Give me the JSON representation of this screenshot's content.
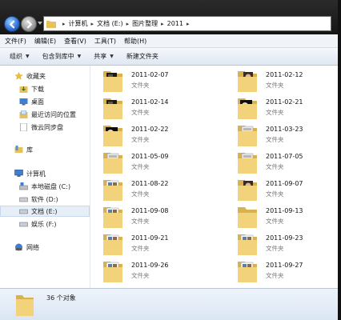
{
  "address": {
    "crumbs": [
      "计算机",
      "文档 (E:)",
      "图片整理",
      "2011"
    ]
  },
  "menu": [
    "文件(F)",
    "编辑(E)",
    "查看(V)",
    "工具(T)",
    "帮助(H)"
  ],
  "toolbar": {
    "organize": "组织",
    "include_library": "包含到库中",
    "share": "共享",
    "new_folder": "新建文件夹"
  },
  "nav": {
    "favorites": "收藏夹",
    "downloads": "下载",
    "desktop": "桌面",
    "recent": "最近访问的位置",
    "weiyun": "微云同步盘",
    "library": "库",
    "computer": "计算机",
    "drive_c": "本地磁盘 (C:)",
    "drive_d": "软件 (D:)",
    "drive_e": "文档 (E:)",
    "drive_f": "娱乐 (F:)",
    "network": "网络"
  },
  "folder_kind": "文件夹",
  "folders": [
    {
      "name": "2011-02-07",
      "thumb": "dark-photo"
    },
    {
      "name": "2011-02-12",
      "thumb": "portrait"
    },
    {
      "name": "2011-02-14",
      "thumb": "dark-photo"
    },
    {
      "name": "2011-02-21",
      "thumb": "bw-photo"
    },
    {
      "name": "2011-02-22",
      "thumb": "bw-photo"
    },
    {
      "name": "2011-03-23",
      "thumb": "gray-grid"
    },
    {
      "name": "2011-05-09",
      "thumb": "gray-grid"
    },
    {
      "name": "2011-07-05",
      "thumb": "gray-grid"
    },
    {
      "name": "2011-08-22",
      "thumb": "collage"
    },
    {
      "name": "2011-09-07",
      "thumb": "portrait"
    },
    {
      "name": "2011-09-08",
      "thumb": "collage"
    },
    {
      "name": "2011-09-13",
      "thumb": "plain"
    },
    {
      "name": "2011-09-21",
      "thumb": "collage"
    },
    {
      "name": "2011-09-23",
      "thumb": "collage"
    },
    {
      "name": "2011-09-26",
      "thumb": "collage"
    },
    {
      "name": "2011-09-27",
      "thumb": "collage"
    }
  ],
  "details": {
    "count": "36 个对象"
  },
  "colors": {
    "folder": "#f2d27a",
    "folder_dark": "#d9b250",
    "selection": "#e6eef8"
  }
}
